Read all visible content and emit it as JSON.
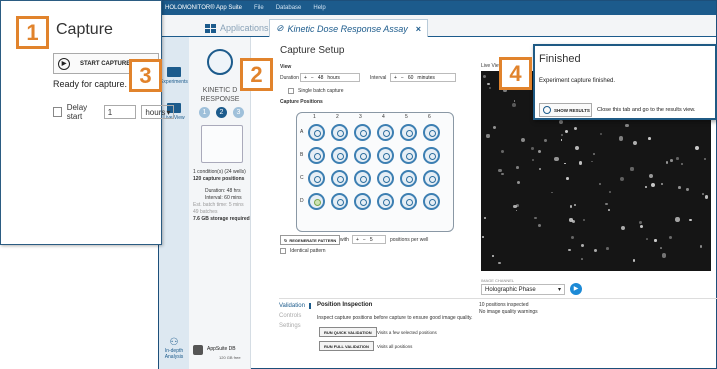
{
  "menubar": {
    "brand": "HOLOMONITOR® App Suite",
    "items": [
      "File",
      "Database",
      "Help"
    ]
  },
  "tabs": {
    "applications": "Applications",
    "current": "Kinetic Dose Response Assay",
    "close": "×"
  },
  "leftnav": {
    "applications": "Applications",
    "experiments": "Experiments",
    "live_view": "Live View",
    "analysis": "In-depth Analysis"
  },
  "wizard": {
    "title_line1": "KINETIC D",
    "title_line2": "RESPONSE",
    "steps": [
      "1",
      "2",
      "3"
    ],
    "conditions": "1 condition(s) (24 wells)",
    "positions": "120 capture positions",
    "duration": "Duration: 48 hrs",
    "interval": "Interval: 60 mins",
    "batch_time": "Est. batch time: 5 mins",
    "batches": "49 batches",
    "storage": "7.6 GB storage required",
    "db_name": "AppSuite DB",
    "db_free": "120 GB free"
  },
  "setup": {
    "title": "Capture Setup",
    "view_label": "View",
    "duration_label": "Duration",
    "duration_value": "48",
    "duration_unit": "hours",
    "interval_label": "Interval",
    "interval_value": "60",
    "interval_unit": "minutes",
    "single_batch": "Single batch capture",
    "capture_positions": "Capture Positions",
    "rows": [
      "A",
      "B",
      "C",
      "D"
    ],
    "cols": [
      "1",
      "2",
      "3",
      "4",
      "5",
      "6"
    ],
    "regenerate": "REGENERATE PATTERN",
    "with_label": "with",
    "positions_value": "5",
    "positions_label": "positions per well",
    "identical": "Identical pattern"
  },
  "liveview": {
    "label": "Live View",
    "channel_label": "IMAGE CHANNEL",
    "channel_value": "Holographic Phase"
  },
  "bottom": {
    "tabs": [
      "Validation",
      "Controls",
      "Settings"
    ],
    "title": "Position Inspection",
    "desc": "Inspect capture positions before capture to ensure good image quality.",
    "quick_btn": "RUN QUICK VALIDATION",
    "quick_desc": "Visits a few selected positions",
    "full_btn": "RUN FULL VALIDATION",
    "full_desc": "Visits all positions",
    "inspected": "10 positions inspected",
    "warnings": "No image quality warnings"
  },
  "capture": {
    "title": "Capture",
    "start": "START CAPTURE",
    "ready": "Ready for capture.",
    "delay_label": "Delay start",
    "delay_value": "1",
    "delay_unit": "hours"
  },
  "finished": {
    "title": "Finished",
    "text": "Experiment capture finished.",
    "button": "SHOW RESULTS",
    "hint": "Close this tab and go to the results view."
  },
  "badges": [
    "1",
    "2",
    "3",
    "4"
  ],
  "colors": {
    "accent": "#1c5b8c",
    "badge": "#e1832c"
  }
}
